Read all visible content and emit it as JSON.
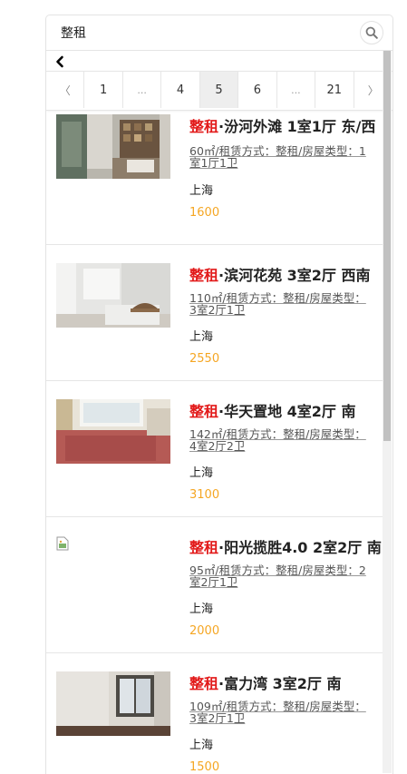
{
  "search": {
    "value": "整租",
    "button_icon": "search-icon"
  },
  "nav": {
    "back_icon": "chevron-left-icon"
  },
  "pagination": {
    "pages": [
      "〈",
      "1",
      "...",
      "4",
      "5",
      "6",
      "...",
      "21",
      "〉"
    ],
    "active": "5"
  },
  "listings": [
    {
      "tag": "整租",
      "title": "·汾河外滩 1室1厅 东/西",
      "meta": "60㎡/租赁方式：整租/房屋类型：1室1厅1卫",
      "city": "上海",
      "price": "1600"
    },
    {
      "tag": "整租",
      "title": "·滨河花苑 3室2厅 西南",
      "meta": "110㎡/租赁方式：整租/房屋类型：3室2厅1卫",
      "city": "上海",
      "price": "2550"
    },
    {
      "tag": "整租",
      "title": "·华天置地 4室2厅 南",
      "meta": "142㎡/租赁方式：整租/房屋类型：4室2厅2卫",
      "city": "上海",
      "price": "3100"
    },
    {
      "tag": "整租",
      "title": "·阳光揽胜4.0 2室2厅 南",
      "meta": "95㎡/租赁方式：整租/房屋类型：2室2厅1卫",
      "city": "上海",
      "price": "2000"
    },
    {
      "tag": "整租",
      "title": "·富力湾 3室2厅 南",
      "meta": "109㎡/租赁方式：整租/房屋类型：3室2厅1卫",
      "city": "上海",
      "price": "1500"
    }
  ],
  "colors": {
    "tag": "#e21a1a",
    "price": "#f5a623",
    "active_page": "#eeeeee"
  }
}
